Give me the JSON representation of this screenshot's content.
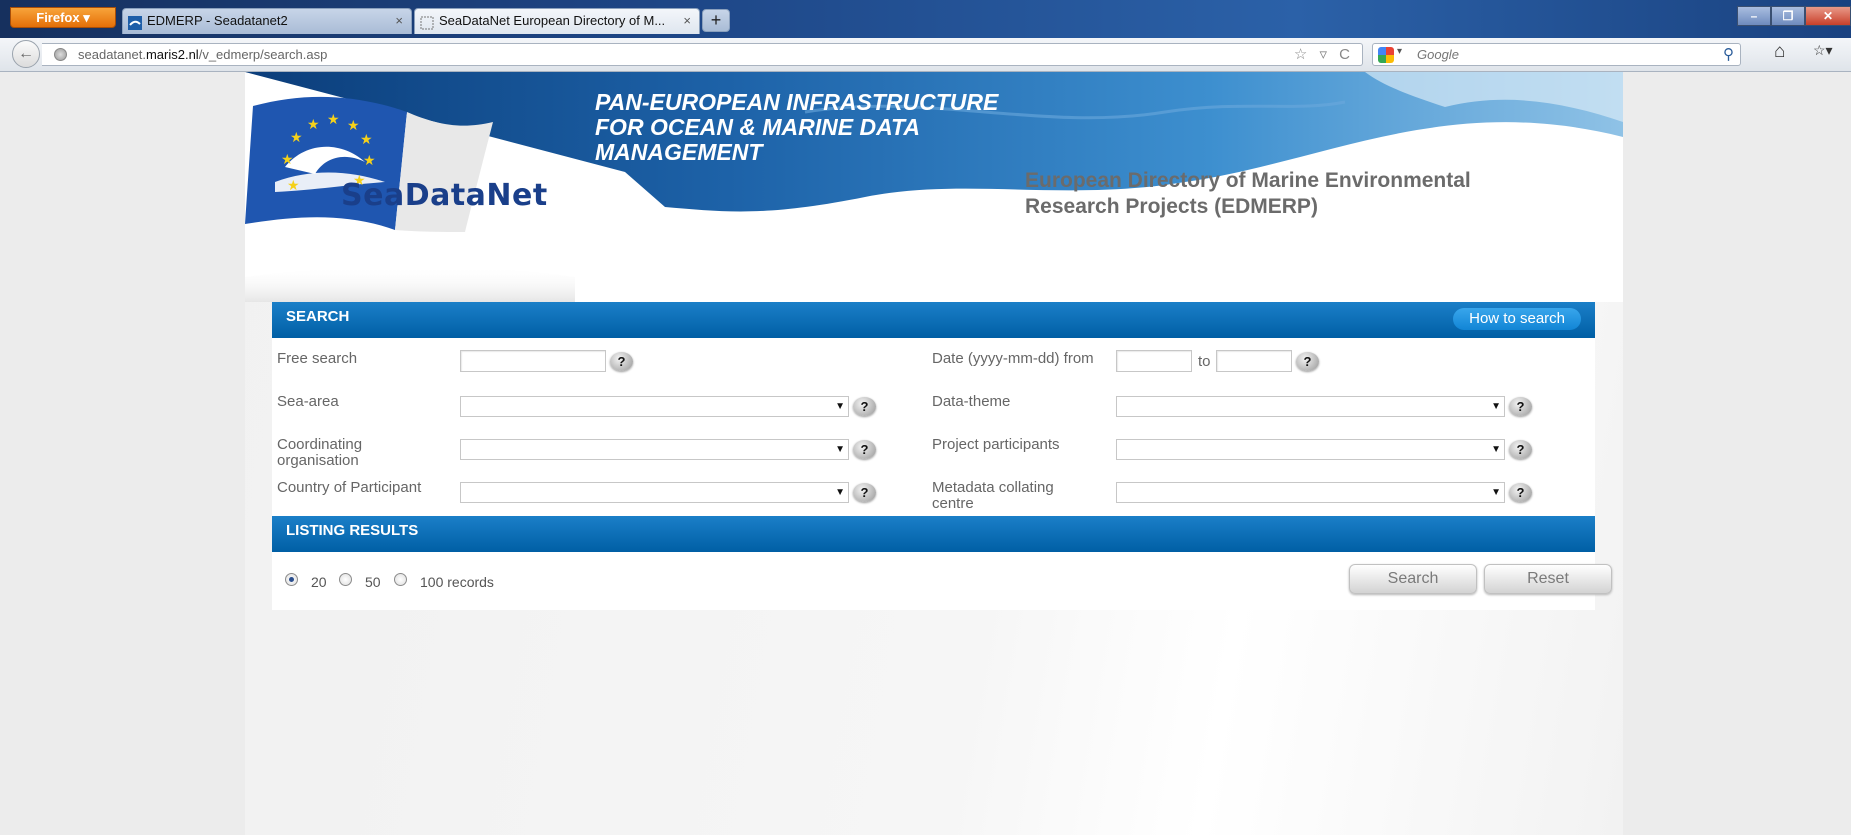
{
  "browser": {
    "menu_button": "Firefox ▾",
    "tabs": [
      {
        "title": "EDMERP - Seadatanet2",
        "close": "×"
      },
      {
        "title": "SeaDataNet European Directory of M...",
        "close": "×"
      }
    ],
    "new_tab": "+",
    "window_controls": {
      "minimize": "–",
      "maximize": "❐",
      "close": "✕"
    },
    "back": "←",
    "url_prefix": "seadatanet.",
    "url_domain": "maris2.nl",
    "url_path": "/v_edmerp/search.asp",
    "url_icons": "☆ ▿ C",
    "search_engine_caret": "▾",
    "search_placeholder": "Google",
    "search_icon": "⚲",
    "home_icon": "⌂",
    "bookmarks_icon": "☆▾"
  },
  "banner": {
    "tagline": "PAN-EUROPEAN INFRASTRUCTURE\nFOR OCEAN & MARINE DATA\nMANAGEMENT",
    "brand": "SeaDataNet",
    "subtitle": "European Directory of Marine Environmental\nResearch Projects (EDMERP)"
  },
  "search": {
    "header": "SEARCH",
    "how_to": "How to search",
    "help": "?",
    "labels": {
      "free_search": "Free search",
      "date_from": "Date (yyyy-mm-dd) from",
      "date_to": "to",
      "sea_area": "Sea-area",
      "data_theme": "Data-theme",
      "coordinating_org": "Coordinating\norganisation",
      "project_participants": "Project participants",
      "country": "Country of Participant",
      "metadata_centre": "Metadata collating\ncentre"
    },
    "values": {
      "free_search": "",
      "date_from": "",
      "date_to": "",
      "sea_area": "",
      "data_theme": "",
      "coordinating_org": "",
      "project_participants": "",
      "country": "",
      "metadata_centre": ""
    },
    "caret": "▼"
  },
  "listing": {
    "header": "LISTING RESULTS",
    "options": [
      {
        "label": "20",
        "checked": true
      },
      {
        "label": "50",
        "checked": false
      },
      {
        "label": "100 records",
        "checked": false
      }
    ],
    "search_button": "Search",
    "reset_button": "Reset"
  },
  "colors": {
    "bar_blue": "#0b6fb8",
    "titlebar_blue": "#1d4585",
    "firefox_orange": "#e8770f",
    "brand_blue": "#1a3f8a"
  }
}
